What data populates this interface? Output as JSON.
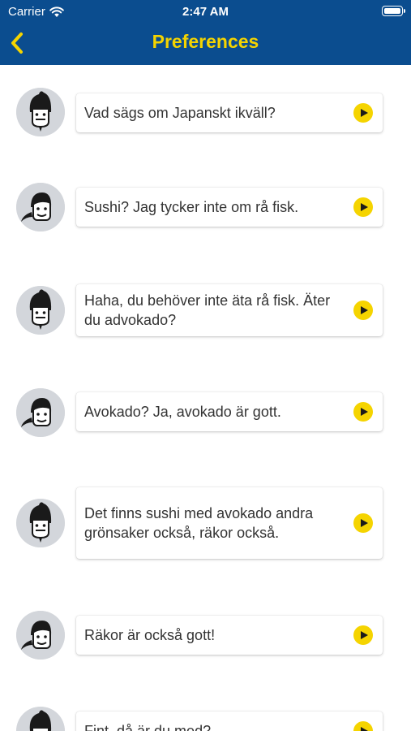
{
  "status_bar": {
    "carrier": "Carrier",
    "time": "2:47 AM"
  },
  "nav": {
    "title": "Preferences",
    "back_icon": "chevron-left-icon"
  },
  "colors": {
    "header_bg": "#0b4d8f",
    "accent": "#f5d400",
    "avatar_bg": "#d3d6db"
  },
  "messages": [
    {
      "speaker": "man-with-goatee",
      "text": "Vad sägs om Japanskt ikväll?"
    },
    {
      "speaker": "woman-with-ponytail",
      "text": "Sushi? Jag tycker inte om rå fisk."
    },
    {
      "speaker": "man-with-goatee",
      "text": "Haha, du behöver inte äta rå fisk. Äter du advokado?"
    },
    {
      "speaker": "woman-with-ponytail",
      "text": "Avokado? Ja, avokado är gott."
    },
    {
      "speaker": "man-with-goatee",
      "text": "Det finns sushi med avokado andra grönsaker också, räkor också."
    },
    {
      "speaker": "woman-with-ponytail",
      "text": "Räkor är också gott!"
    },
    {
      "speaker": "man-with-goatee",
      "text": "Fint, då är du med?"
    }
  ]
}
